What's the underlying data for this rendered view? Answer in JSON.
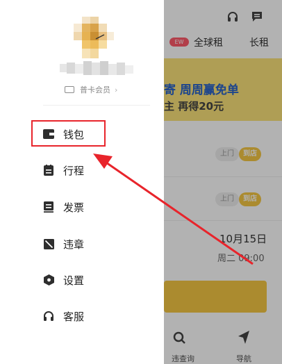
{
  "drawer": {
    "member_label": "普卡会员",
    "member_arrow": "›",
    "menu": [
      {
        "label": "钱包",
        "icon": "wallet-icon"
      },
      {
        "label": "行程",
        "icon": "trip-list-icon"
      },
      {
        "label": "发票",
        "icon": "invoice-icon"
      },
      {
        "label": "违章",
        "icon": "violation-icon"
      },
      {
        "label": "设置",
        "icon": "settings-icon"
      },
      {
        "label": "客服",
        "icon": "headset-icon"
      }
    ]
  },
  "background": {
    "tabs": {
      "badge": "EW",
      "tab1": "全球租",
      "tab2": "长租"
    },
    "banner": {
      "line1_pre": "寄 周周赢",
      "line1_hl": "免单",
      "line2": "主 再得20元"
    },
    "rows": [
      {
        "left": "上门",
        "right": "到店"
      },
      {
        "left": "上门",
        "right": "到店"
      }
    ],
    "date": "10月15日",
    "time": "周二 09:00",
    "bottom": {
      "left_label": "违查询",
      "right_label": "导航"
    }
  },
  "colors": {
    "accent_yellow": "#f5c844",
    "highlight_red": "#e8242b",
    "banner_blue": "#2a63c9"
  }
}
